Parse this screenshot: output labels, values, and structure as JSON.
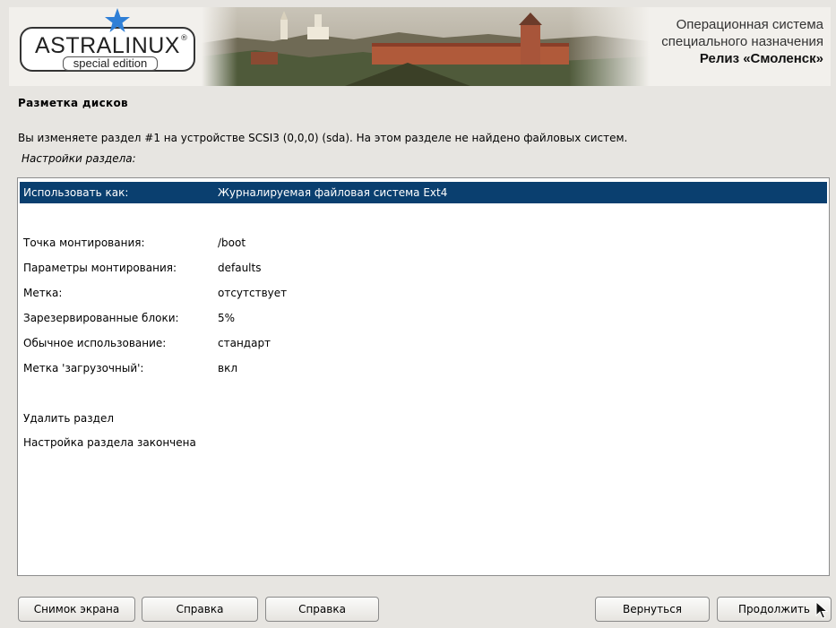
{
  "header": {
    "logo": {
      "name": "ASTRALINUX",
      "registered": "®",
      "edition": "special edition"
    },
    "os_title_line1": "Операционная система",
    "os_title_line2": "специального назначения",
    "os_release": "Релиз «Смоленск»"
  },
  "page": {
    "title": "Разметка дисков",
    "description": "Вы изменяете раздел #1 на устройстве SCSI3 (0,0,0) (sda). На этом разделе не найдено файловых систем.",
    "subtitle": "Настройки раздела:"
  },
  "settings": {
    "use_as": {
      "label": "Использовать как:",
      "value": "Журналируемая файловая система Ext4"
    },
    "mount_point": {
      "label": "Точка монтирования:",
      "value": "/boot"
    },
    "mount_options": {
      "label": "Параметры монтирования:",
      "value": "defaults"
    },
    "fs_label": {
      "label": "Метка:",
      "value": "отсутствует"
    },
    "reserved_blocks": {
      "label": "Зарезервированные блоки:",
      "value": "5%"
    },
    "typical_usage": {
      "label": "Обычное использование:",
      "value": "стандарт"
    },
    "bootable": {
      "label": "Метка 'загрузочный':",
      "value": "вкл"
    },
    "delete_partition": "Удалить раздел",
    "done": "Настройка раздела закончена"
  },
  "buttons": {
    "screenshot": "Снимок экрана",
    "help1": "Справка",
    "help2": "Справка",
    "back": "Вернуться",
    "continue": "Продолжить"
  },
  "colors": {
    "selection": "#0a3f6f",
    "logo_star": "#2f7fd6"
  }
}
